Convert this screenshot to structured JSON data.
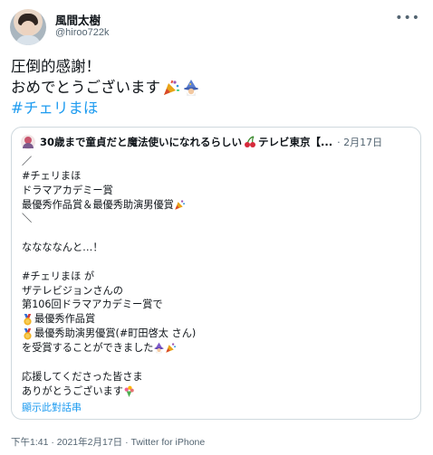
{
  "author": {
    "display_name": "風間太樹",
    "handle": "@hiroo722k"
  },
  "tweet": {
    "line1": "圧倒的感謝！",
    "line2": "おめでとうございます",
    "hashtag": "#チェリまほ"
  },
  "quoted": {
    "author_name": "30歳まで童貞だと魔法使いになれるらしい",
    "author_suffix": "テレビ東京【...",
    "date": "2月17日",
    "lines": [
      "／",
      "#チェリまほ",
      "ドラマアカデミー賞",
      "最優秀作品賞＆最優秀助演男優賞",
      "＼",
      "",
      "ななななんと…！",
      "",
      "#チェリまほ が",
      "ザテレビジョンさんの",
      "第106回ドラマアカデミー賞で",
      "最優秀作品賞",
      "最優秀助演男優賞(#町田啓太 さん)",
      "を受賞することができました",
      "",
      "応援してくださった皆さま",
      "ありがとうございます"
    ],
    "translate_label": "顯示此對話串"
  },
  "meta": {
    "time": "下午1:41",
    "date": "2021年2月17日",
    "source": "Twitter for iPhone",
    "separator": "·"
  },
  "icons": {
    "more": "more-dots-icon",
    "party": "party-popper-icon",
    "wizard": "wizard-icon",
    "cherries": "cherries-icon",
    "medal": "medal-icon",
    "bouquet": "bouquet-icon"
  },
  "colors": {
    "link": "#1d9bf0",
    "secondary": "#536471",
    "border": "#cfd9de"
  }
}
